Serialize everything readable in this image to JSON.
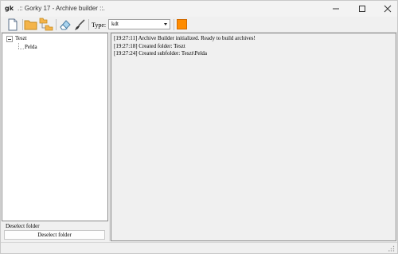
{
  "window": {
    "title": ".:: Gorky 17 - Archive builder ::.",
    "app_icon": "gk"
  },
  "toolbar": {
    "type_label": "Type:",
    "type_value": "kdt",
    "icons": [
      "new-file-icon",
      "open-folder-icon",
      "folder-tree-icon",
      "eraser-icon",
      "brush-icon",
      "orange-square-icon"
    ],
    "accent_color": "#ff8c00"
  },
  "tree": {
    "root": "Teszt",
    "child": "Pelda"
  },
  "left_bottom": {
    "label": "Deselect folder",
    "button": "Deselect folder"
  },
  "log": {
    "lines": [
      "[19:27:11] Archive Builder initialized. Ready to build archives!",
      "[19:27:18] Created folder: Teszt",
      "[19:27:24] Created subfolder: Teszt\\Pelda"
    ]
  }
}
